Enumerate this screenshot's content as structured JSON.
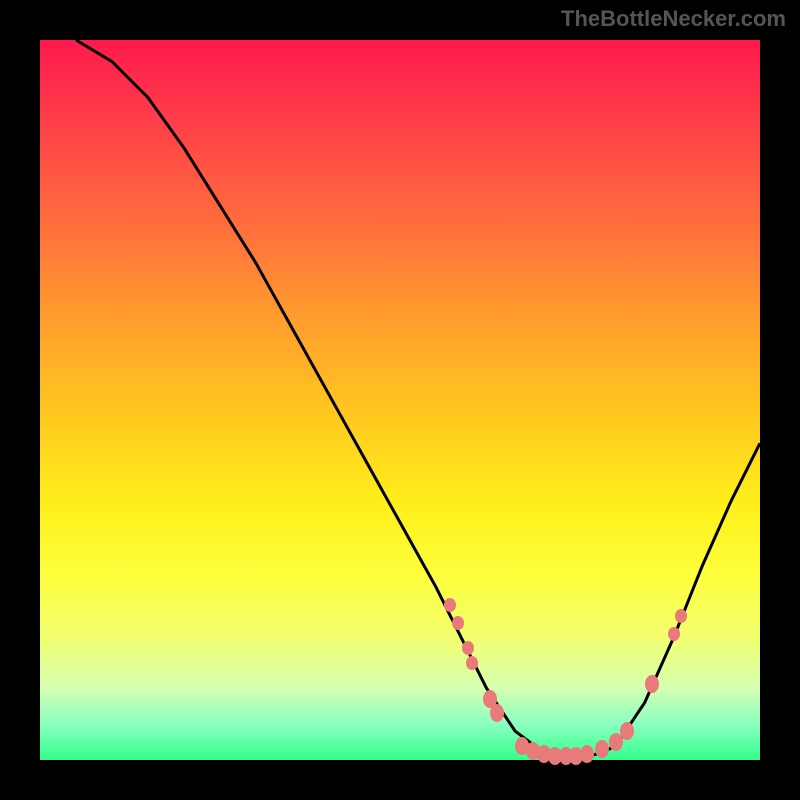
{
  "watermark_text": "TheBottleNecker.com",
  "chart_data": {
    "type": "line",
    "title": "",
    "xlabel": "",
    "ylabel": "",
    "xlim": [
      0,
      100
    ],
    "ylim": [
      0,
      100
    ],
    "curve": {
      "name": "bottleneck-curve",
      "x": [
        5,
        10,
        15,
        20,
        25,
        30,
        35,
        40,
        45,
        50,
        55,
        58,
        62,
        66,
        70,
        74,
        78,
        80,
        84,
        88,
        92,
        96,
        100
      ],
      "y": [
        100,
        97,
        92,
        85,
        77,
        69,
        60,
        51,
        42,
        33,
        24,
        18,
        10,
        4,
        1,
        0,
        1,
        2,
        8,
        17,
        27,
        36,
        44
      ]
    },
    "markers": [
      {
        "x": 57.0,
        "y": 21.5
      },
      {
        "x": 58.0,
        "y": 19.0
      },
      {
        "x": 59.5,
        "y": 15.5
      },
      {
        "x": 60.0,
        "y": 13.5
      },
      {
        "x": 62.5,
        "y": 8.5
      },
      {
        "x": 63.5,
        "y": 6.5
      },
      {
        "x": 67.0,
        "y": 2.0
      },
      {
        "x": 68.5,
        "y": 1.2
      },
      {
        "x": 70.0,
        "y": 0.8
      },
      {
        "x": 71.5,
        "y": 0.5
      },
      {
        "x": 73.0,
        "y": 0.5
      },
      {
        "x": 74.5,
        "y": 0.5
      },
      {
        "x": 76.0,
        "y": 0.8
      },
      {
        "x": 78.0,
        "y": 1.5
      },
      {
        "x": 80.0,
        "y": 2.5
      },
      {
        "x": 81.5,
        "y": 4.0
      },
      {
        "x": 85.0,
        "y": 10.5
      },
      {
        "x": 88.0,
        "y": 17.5
      },
      {
        "x": 89.0,
        "y": 20.0
      }
    ],
    "background_gradient_stops": [
      {
        "pos": 0,
        "color": "#ff1a4d"
      },
      {
        "pos": 100,
        "color": "#32ff8a"
      }
    ]
  }
}
